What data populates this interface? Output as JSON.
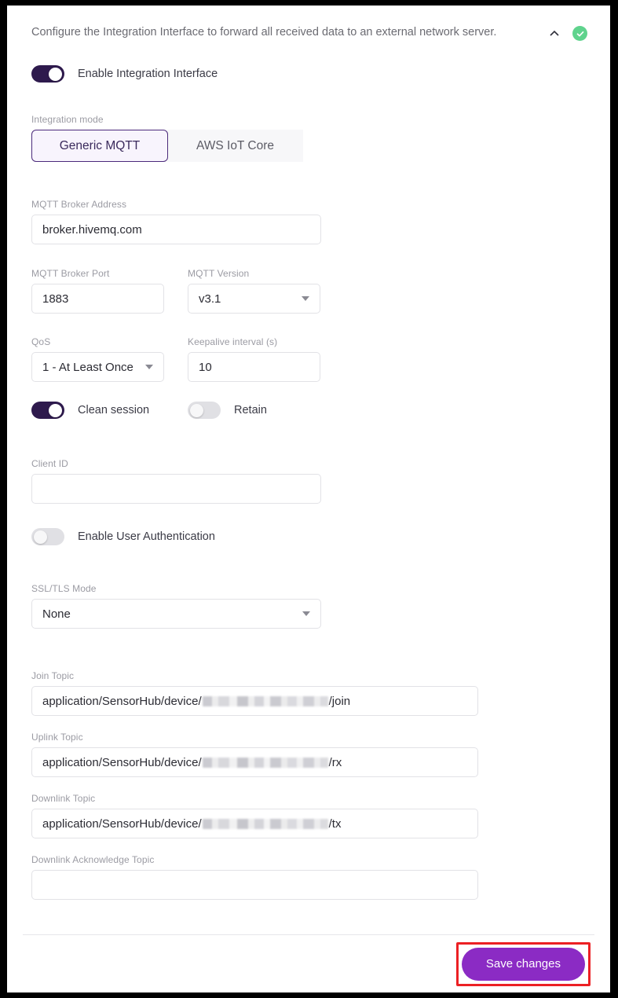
{
  "panel": {
    "description": "Configure the Integration Interface to forward all received data to an external network server.",
    "collapse_icon": "chevron-up-icon",
    "status_icon": "check-circle-icon",
    "status_color": "#5fd38d"
  },
  "enable_toggle": {
    "label": "Enable Integration Interface",
    "state": "on"
  },
  "integration_mode": {
    "label": "Integration mode",
    "options": [
      "Generic MQTT",
      "AWS IoT Core"
    ],
    "selected": "Generic MQTT"
  },
  "fields": {
    "broker_address": {
      "label": "MQTT Broker Address",
      "value": "broker.hivemq.com"
    },
    "broker_port": {
      "label": "MQTT Broker Port",
      "value": "1883"
    },
    "mqtt_version": {
      "label": "MQTT Version",
      "value": "v3.1"
    },
    "qos": {
      "label": "QoS",
      "value": "1 - At Least Once"
    },
    "keepalive": {
      "label": "Keepalive interval (s)",
      "value": "10"
    },
    "client_id": {
      "label": "Client ID",
      "value": ""
    },
    "ssl_tls_mode": {
      "label": "SSL/TLS Mode",
      "value": "None"
    }
  },
  "toggles": {
    "clean_session": {
      "label": "Clean session",
      "state": "on"
    },
    "retain": {
      "label": "Retain",
      "state": "off"
    },
    "user_auth": {
      "label": "Enable User Authentication",
      "state": "off"
    }
  },
  "topics": {
    "join": {
      "label": "Join Topic",
      "prefix": "application/SensorHub/device/",
      "redacted": true,
      "suffix": "/join"
    },
    "uplink": {
      "label": "Uplink Topic",
      "prefix": "application/SensorHub/device/",
      "redacted": true,
      "suffix": "/rx"
    },
    "downlink": {
      "label": "Downlink Topic",
      "prefix": "application/SensorHub/device/",
      "redacted": true,
      "suffix": "/tx"
    },
    "downlink_ack": {
      "label": "Downlink Acknowledge Topic"
    }
  },
  "footer": {
    "save_label": "Save changes",
    "save_color": "#8b2bc4",
    "highlight_color": "#ec2024"
  }
}
